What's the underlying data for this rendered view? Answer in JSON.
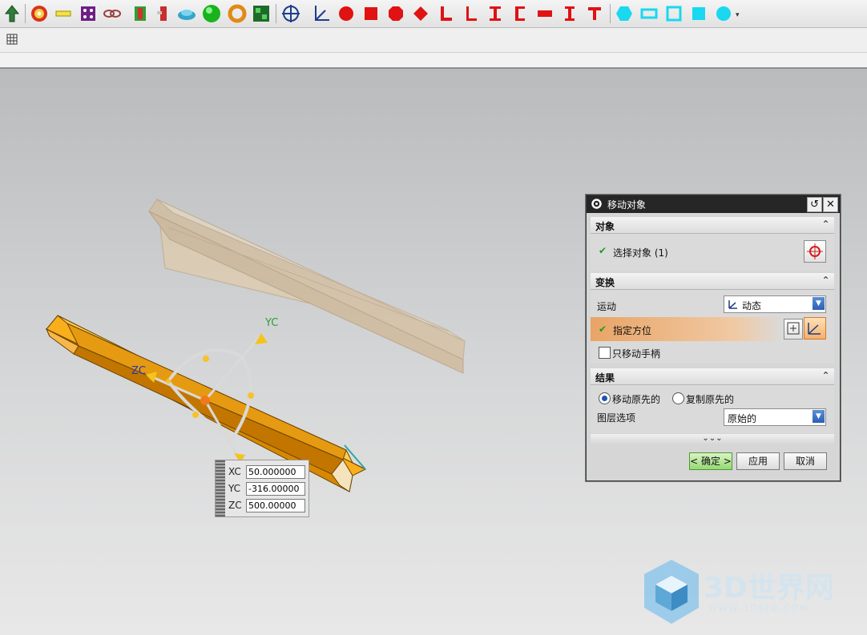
{
  "toolbar": {
    "icons": [
      "pointer-arrow-icon",
      "gear-flower-icon",
      "yellow-bar-icon",
      "purple-square-icon",
      "chain-link-icon",
      "green-profile-icon",
      "red-tag-icon",
      "cyan-shape-icon",
      "green-sphere-icon",
      "orange-ring-icon",
      "green-board-icon",
      "crosshair-icon",
      "axis-icon",
      "red-circle-icon",
      "red-square-icon",
      "red-octagon-icon",
      "red-diamond-icon",
      "red-angle-icon",
      "red-angle-2-icon",
      "red-i-beam-icon",
      "red-channel-icon",
      "red-rect-icon",
      "red-i-icon",
      "red-t-icon",
      "cyan-hex-icon",
      "cyan-rect-icon",
      "cyan-square-icon",
      "cyan-square-2-icon",
      "cyan-circle-icon"
    ],
    "overflow": "▾"
  },
  "coord": {
    "rows": [
      {
        "label": "XC",
        "value": "50.000000"
      },
      {
        "label": "YC",
        "value": "-316.00000"
      },
      {
        "label": "ZC",
        "value": "500.00000"
      }
    ]
  },
  "model": {
    "axis_y": "YC",
    "axis_z": "ZC"
  },
  "dialog": {
    "title": "移动对象",
    "sections": {
      "object": "对象",
      "transform": "变换",
      "result": "结果"
    },
    "select_object": "选择对象 (1)",
    "motion_label": "运动",
    "motion_value": "动态",
    "specify_orientation": "指定方位",
    "move_handle_only": "只移动手柄",
    "move_original": "移动原先的",
    "copy_original": "复制原先的",
    "layer_label": "图层选项",
    "layer_value": "原始的",
    "more": "⌄⌄⌄",
    "ok": "< 确定 >",
    "apply": "应用",
    "cancel": "取消"
  },
  "watermark": {
    "text": "3D世界网",
    "url": "WWW.3DSJW.COM"
  },
  "colors": {
    "beam": "#f3a21c",
    "ghost_beam": "#d8b98c",
    "gradient_bar": "#e9a466",
    "title_bar": "#262626"
  }
}
